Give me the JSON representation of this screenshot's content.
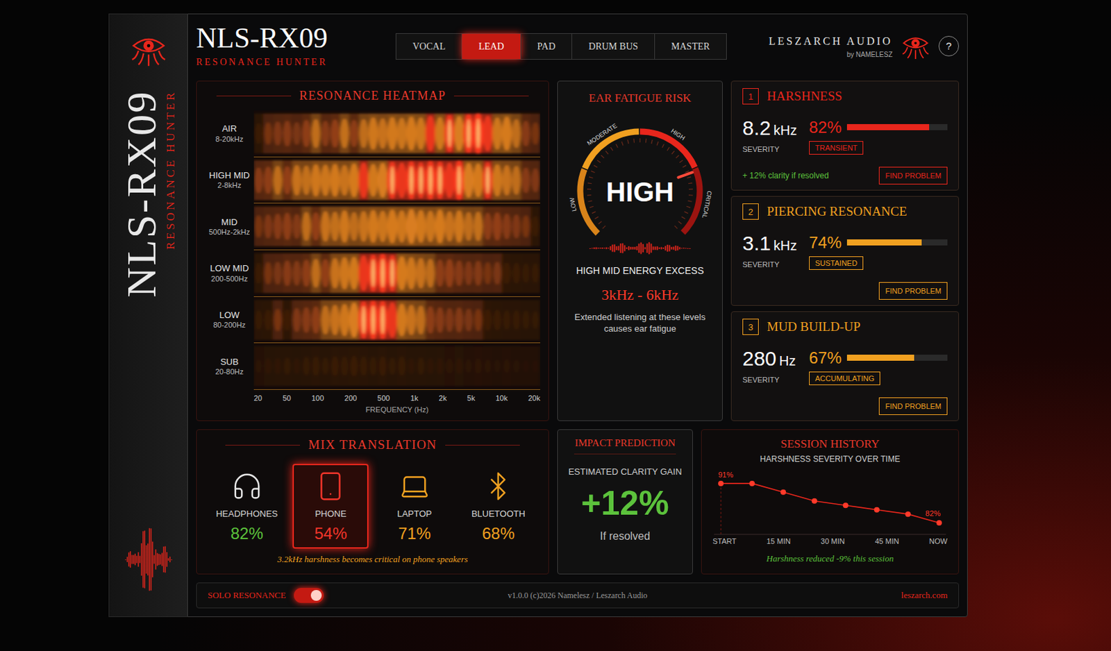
{
  "spine": {
    "title": "NLS-RX09",
    "subtitle": "RESONANCE HUNTER"
  },
  "header": {
    "title": "NLS-RX09",
    "subtitle": "RESONANCE HUNTER",
    "brand": "LESZARCH AUDIO",
    "brand_by": "by NAMELESZ",
    "help": "?"
  },
  "tabs": [
    {
      "label": "VOCAL",
      "selected": false
    },
    {
      "label": "LEAD",
      "selected": true
    },
    {
      "label": "PAD",
      "selected": false
    },
    {
      "label": "DRUM BUS",
      "selected": false
    },
    {
      "label": "MASTER",
      "selected": false
    }
  ],
  "heatmap": {
    "title": "RESONANCE HEATMAP",
    "bands": [
      {
        "name": "AIR",
        "range": "8-20kHz",
        "values": [
          0.35,
          0.4,
          0.45,
          0.5,
          0.42,
          0.55,
          0.6,
          0.5,
          0.58,
          0.62,
          0.55,
          0.6,
          0.7,
          0.65,
          0.72,
          0.68,
          0.75,
          0.7,
          0.8,
          0.72,
          0.85,
          0.78,
          0.9,
          0.95,
          0.8,
          0.7,
          0.75,
          0.6,
          0.5,
          0.4
        ]
      },
      {
        "name": "HIGH MID",
        "range": "2-8kHz",
        "values": [
          0.5,
          0.55,
          0.6,
          0.58,
          0.65,
          0.62,
          0.7,
          0.68,
          0.72,
          0.66,
          0.75,
          0.8,
          0.72,
          0.78,
          0.85,
          0.8,
          0.88,
          0.82,
          0.9,
          0.86,
          0.8,
          0.92,
          0.78,
          0.75,
          0.82,
          0.7,
          0.65,
          0.6,
          0.5,
          0.45
        ]
      },
      {
        "name": "MID",
        "range": "500Hz-2kHz",
        "values": [
          0.4,
          0.45,
          0.5,
          0.55,
          0.48,
          0.6,
          0.58,
          0.65,
          0.62,
          0.7,
          0.6,
          0.66,
          0.72,
          0.68,
          0.75,
          0.7,
          0.78,
          0.72,
          0.68,
          0.75,
          0.65,
          0.7,
          0.6,
          0.62,
          0.55,
          0.58,
          0.5,
          0.45,
          0.4,
          0.35
        ]
      },
      {
        "name": "LOW MID",
        "range": "200-500Hz",
        "values": [
          0.35,
          0.4,
          0.42,
          0.5,
          0.48,
          0.55,
          0.6,
          0.58,
          0.65,
          0.7,
          0.72,
          0.8,
          0.85,
          0.9,
          0.82,
          0.75,
          0.7,
          0.65,
          0.6,
          0.55,
          0.58,
          0.5,
          0.45,
          0.48,
          0.4,
          0.42,
          0.38,
          0.35,
          0.3,
          0.3
        ]
      },
      {
        "name": "LOW",
        "range": "80-200Hz",
        "values": [
          0.3,
          0.35,
          0.4,
          0.38,
          0.45,
          0.5,
          0.55,
          0.6,
          0.65,
          0.7,
          0.78,
          0.85,
          0.9,
          0.88,
          0.8,
          0.72,
          0.65,
          0.6,
          0.55,
          0.5,
          0.45,
          0.48,
          0.42,
          0.4,
          0.38,
          0.35,
          0.3,
          0.3,
          0.28,
          0.25
        ]
      },
      {
        "name": "SUB",
        "range": "20-80Hz",
        "values": [
          0.15,
          0.2,
          0.22,
          0.25,
          0.2,
          0.28,
          0.3,
          0.25,
          0.32,
          0.3,
          0.35,
          0.3,
          0.28,
          0.32,
          0.25,
          0.3,
          0.22,
          0.25,
          0.2,
          0.22,
          0.18,
          0.2,
          0.15,
          0.18,
          0.15,
          0.12,
          0.15,
          0.12,
          0.1,
          0.1
        ]
      }
    ],
    "x_ticks": [
      "20",
      "50",
      "100",
      "200",
      "500",
      "1k",
      "2k",
      "5k",
      "10k",
      "20k"
    ],
    "x_label": "FREQUENCY (Hz)"
  },
  "fatigue": {
    "title": "EAR FATIGUE RISK",
    "scale": [
      "LOW",
      "MODERATE",
      "HIGH",
      "CRITICAL"
    ],
    "reading": "HIGH",
    "level": 0.76,
    "headline": "HIGH MID ENERGY EXCESS",
    "range": "3kHz - 6kHz",
    "note": "Extended listening at these levels causes ear fatigue"
  },
  "problems": [
    {
      "index": "1",
      "title": "HARSHNESS",
      "freq": "8.2",
      "unit": "kHz",
      "severity_label": "SEVERITY",
      "percent": "82%",
      "level": 0.82,
      "tag": "TRANSIENT",
      "color": "#e8261c",
      "hint": "+ 12% clarity if resolved",
      "button": "FIND PROBLEM"
    },
    {
      "index": "2",
      "title": "PIERCING RESONANCE",
      "freq": "3.1",
      "unit": "kHz",
      "severity_label": "SEVERITY",
      "percent": "74%",
      "level": 0.74,
      "tag": "SUSTAINED",
      "color": "#f0a020",
      "hint": "",
      "button": "FIND PROBLEM"
    },
    {
      "index": "3",
      "title": "MUD BUILD-UP",
      "freq": "280",
      "unit": "Hz",
      "severity_label": "SEVERITY",
      "percent": "67%",
      "level": 0.67,
      "tag": "ACCUMULATING",
      "color": "#f0a020",
      "hint": "",
      "button": "FIND PROBLEM"
    }
  ],
  "translation": {
    "title": "MIX TRANSLATION",
    "devices": [
      {
        "name": "HEADPHONES",
        "percent": "82%",
        "kind": "headphones",
        "color": "#5cc23c",
        "icon_color": "#e5e5e5",
        "selected": false
      },
      {
        "name": "PHONE",
        "percent": "54%",
        "kind": "phone",
        "color": "#f0352a",
        "icon_color": "#f0352a",
        "selected": true
      },
      {
        "name": "LAPTOP",
        "percent": "71%",
        "kind": "laptop",
        "color": "#f0a020",
        "icon_color": "#f0a020",
        "selected": false
      },
      {
        "name": "BLUETOOTH",
        "percent": "68%",
        "kind": "bluetooth",
        "color": "#f0a020",
        "icon_color": "#f0a020",
        "selected": false
      }
    ],
    "note": "3.2kHz harshness becomes critical on phone speakers"
  },
  "impact": {
    "title": "IMPACT PREDICTION",
    "label": "ESTIMATED CLARITY GAIN",
    "value": "+12%",
    "note": "If resolved"
  },
  "history": {
    "title": "SESSION HISTORY",
    "subtitle": "HARSHNESS SEVERITY OVER TIME",
    "values": [
      91,
      91,
      89,
      87,
      86,
      85,
      84,
      82
    ],
    "start_label": "91%",
    "end_label": "82%",
    "x_ticks": [
      "START",
      "15 MIN",
      "30 MIN",
      "45 MIN",
      "NOW"
    ],
    "note": "Harshness reduced -9% this session"
  },
  "footer": {
    "solo_label": "SOLO RESONANCE",
    "solo_on": true,
    "version": "v1.0.0 (c)2026 Namelesz / Leszarch Audio",
    "link": "leszarch.com"
  }
}
